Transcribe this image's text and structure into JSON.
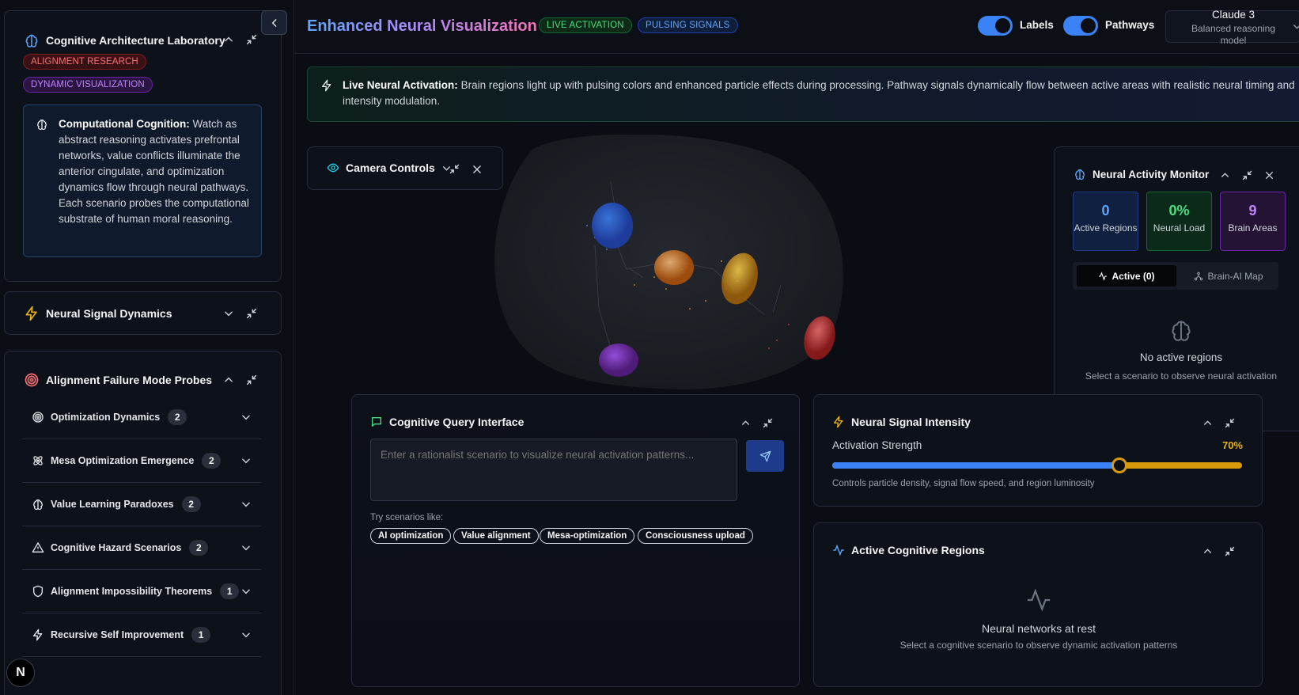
{
  "sidebar": {
    "lab": {
      "title": "Cognitive Architecture Laboratory",
      "badges": [
        "ALIGNMENT RESEARCH",
        "DYNAMIC VISUALIZATION"
      ],
      "info_bold": "Computational Cognition:",
      "info_text": "Watch as abstract reasoning activates prefrontal networks, value conflicts illuminate the anterior cingulate, and optimization dynamics flow through neural pathways. Each scenario probes the computational substrate of human moral reasoning."
    },
    "signal_dynamics": {
      "title": "Neural Signal Dynamics"
    },
    "probes": {
      "title": "Alignment Failure Mode Probes",
      "items": [
        {
          "label": "Optimization Dynamics",
          "count": "2",
          "icon": "target-icon"
        },
        {
          "label": "Mesa Optimization Emergence",
          "count": "2",
          "icon": "atom-icon"
        },
        {
          "label": "Value Learning Paradoxes",
          "count": "2",
          "icon": "brain-icon"
        },
        {
          "label": "Cognitive Hazard Scenarios",
          "count": "2",
          "icon": "warning-icon"
        },
        {
          "label": "Alignment Impossibility Theorems",
          "count": "1",
          "icon": "shield-icon"
        },
        {
          "label": "Recursive Self Improvement",
          "count": "1",
          "icon": "lightning-icon"
        }
      ]
    },
    "logo_letter": "N"
  },
  "header": {
    "title": "Enhanced Neural Visualization",
    "tags": [
      "LIVE ACTIVATION",
      "PULSING SIGNALS"
    ],
    "toggles": [
      {
        "label": "Labels",
        "on": true
      },
      {
        "label": "Pathways",
        "on": true
      }
    ],
    "model": {
      "name": "Claude 3",
      "description": "Balanced reasoning model"
    }
  },
  "banner": {
    "bold": "Live Neural Activation:",
    "text": "Brain regions light up with pulsing colors and enhanced particle effects during processing. Pathway signals dynamically flow between active areas with realistic neural timing and intensity modulation."
  },
  "camera": {
    "title": "Camera Controls"
  },
  "monitor": {
    "title": "Neural Activity Monitor",
    "stats": [
      {
        "value": "0",
        "label": "Active Regions",
        "color": "#60a5fa"
      },
      {
        "value": "0%",
        "label": "Neural Load",
        "color": "#4ade80"
      },
      {
        "value": "9",
        "label": "Brain Areas",
        "color": "#c084fc"
      }
    ],
    "tabs": {
      "active": "Active (0)",
      "other": "Brain-AI Map"
    },
    "empty_title": "No active regions",
    "empty_sub": "Select a scenario to observe neural activation"
  },
  "query": {
    "title": "Cognitive Query Interface",
    "placeholder": "Enter a rationalist scenario to visualize neural activation patterns...",
    "try_label": "Try scenarios like:",
    "chips": [
      "AI optimization",
      "Value alignment",
      "Mesa-optimization",
      "Consciousness upload"
    ]
  },
  "intensity": {
    "title": "Neural Signal Intensity",
    "label": "Activation Strength",
    "value_text": "70%",
    "value": 0.7,
    "caption": "Controls particle density, signal flow speed, and region luminosity"
  },
  "regions": {
    "title": "Active Cognitive Regions",
    "empty_title": "Neural networks at rest",
    "empty_sub": "Select a cognitive scenario to observe dynamic activation patterns"
  },
  "colors": {
    "accent_blue": "#3b82f6",
    "accent_amber": "#d99a0a",
    "green": "#4ade80",
    "purple": "#c084fc",
    "red": "#f87171"
  }
}
